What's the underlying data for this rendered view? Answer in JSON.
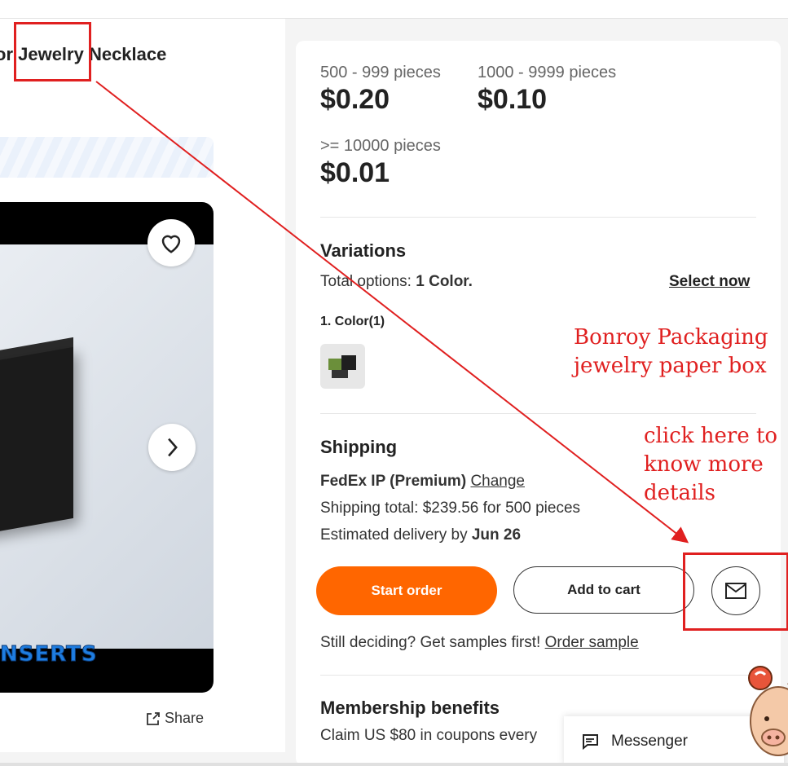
{
  "product": {
    "title": "or Jewelry Necklace",
    "media_caption": "NSERTS",
    "share_label": "Share"
  },
  "pricing": {
    "tiers": [
      {
        "qty": "500 - 999 pieces",
        "price": "$0.20"
      },
      {
        "qty": "1000 - 9999 pieces",
        "price": "$0.10"
      },
      {
        "qty": ">= 10000 pieces",
        "price": "$0.01"
      }
    ]
  },
  "variations": {
    "title": "Variations",
    "total_prefix": "Total options: ",
    "total_value": "1 Color.",
    "select_now": "Select now",
    "color_label": "1. Color(1)"
  },
  "shipping": {
    "title": "Shipping",
    "method": "FedEx IP (Premium)",
    "change": "Change",
    "total": "Shipping total: $239.56 for 500 pieces",
    "delivery_prefix": "Estimated delivery by ",
    "delivery_date": "Jun 26"
  },
  "actions": {
    "start_order": "Start order",
    "add_to_cart": "Add to cart",
    "samples_text": "Still deciding? Get samples first! ",
    "order_sample": "Order sample"
  },
  "membership": {
    "title": "Membership benefits",
    "text": "Claim US $80 in coupons every"
  },
  "messenger": {
    "label": "Messenger"
  },
  "annotations": {
    "note1_line1": "Bonroy Packaging",
    "note1_line2": "jewelry paper box",
    "note2_line1": "click here to",
    "note2_line2": "know more",
    "note2_line3": "details",
    "color": "#e02020"
  },
  "icons": [
    "heart-icon",
    "chevron-right-icon",
    "share-icon",
    "mail-icon",
    "chat-icon"
  ],
  "colors": {
    "accent": "#ff6600"
  }
}
